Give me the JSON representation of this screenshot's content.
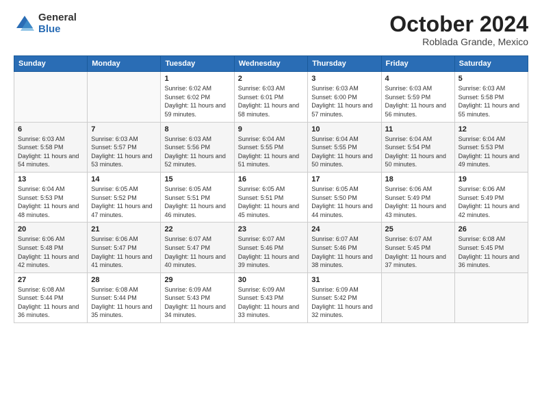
{
  "logo": {
    "general": "General",
    "blue": "Blue"
  },
  "title": "October 2024",
  "location": "Roblada Grande, Mexico",
  "days_header": [
    "Sunday",
    "Monday",
    "Tuesday",
    "Wednesday",
    "Thursday",
    "Friday",
    "Saturday"
  ],
  "weeks": [
    [
      {
        "day": "",
        "info": ""
      },
      {
        "day": "",
        "info": ""
      },
      {
        "day": "1",
        "info": "Sunrise: 6:02 AM\nSunset: 6:02 PM\nDaylight: 11 hours and 59 minutes."
      },
      {
        "day": "2",
        "info": "Sunrise: 6:03 AM\nSunset: 6:01 PM\nDaylight: 11 hours and 58 minutes."
      },
      {
        "day": "3",
        "info": "Sunrise: 6:03 AM\nSunset: 6:00 PM\nDaylight: 11 hours and 57 minutes."
      },
      {
        "day": "4",
        "info": "Sunrise: 6:03 AM\nSunset: 5:59 PM\nDaylight: 11 hours and 56 minutes."
      },
      {
        "day": "5",
        "info": "Sunrise: 6:03 AM\nSunset: 5:58 PM\nDaylight: 11 hours and 55 minutes."
      }
    ],
    [
      {
        "day": "6",
        "info": "Sunrise: 6:03 AM\nSunset: 5:58 PM\nDaylight: 11 hours and 54 minutes."
      },
      {
        "day": "7",
        "info": "Sunrise: 6:03 AM\nSunset: 5:57 PM\nDaylight: 11 hours and 53 minutes."
      },
      {
        "day": "8",
        "info": "Sunrise: 6:03 AM\nSunset: 5:56 PM\nDaylight: 11 hours and 52 minutes."
      },
      {
        "day": "9",
        "info": "Sunrise: 6:04 AM\nSunset: 5:55 PM\nDaylight: 11 hours and 51 minutes."
      },
      {
        "day": "10",
        "info": "Sunrise: 6:04 AM\nSunset: 5:55 PM\nDaylight: 11 hours and 50 minutes."
      },
      {
        "day": "11",
        "info": "Sunrise: 6:04 AM\nSunset: 5:54 PM\nDaylight: 11 hours and 50 minutes."
      },
      {
        "day": "12",
        "info": "Sunrise: 6:04 AM\nSunset: 5:53 PM\nDaylight: 11 hours and 49 minutes."
      }
    ],
    [
      {
        "day": "13",
        "info": "Sunrise: 6:04 AM\nSunset: 5:53 PM\nDaylight: 11 hours and 48 minutes."
      },
      {
        "day": "14",
        "info": "Sunrise: 6:05 AM\nSunset: 5:52 PM\nDaylight: 11 hours and 47 minutes."
      },
      {
        "day": "15",
        "info": "Sunrise: 6:05 AM\nSunset: 5:51 PM\nDaylight: 11 hours and 46 minutes."
      },
      {
        "day": "16",
        "info": "Sunrise: 6:05 AM\nSunset: 5:51 PM\nDaylight: 11 hours and 45 minutes."
      },
      {
        "day": "17",
        "info": "Sunrise: 6:05 AM\nSunset: 5:50 PM\nDaylight: 11 hours and 44 minutes."
      },
      {
        "day": "18",
        "info": "Sunrise: 6:06 AM\nSunset: 5:49 PM\nDaylight: 11 hours and 43 minutes."
      },
      {
        "day": "19",
        "info": "Sunrise: 6:06 AM\nSunset: 5:49 PM\nDaylight: 11 hours and 42 minutes."
      }
    ],
    [
      {
        "day": "20",
        "info": "Sunrise: 6:06 AM\nSunset: 5:48 PM\nDaylight: 11 hours and 42 minutes."
      },
      {
        "day": "21",
        "info": "Sunrise: 6:06 AM\nSunset: 5:47 PM\nDaylight: 11 hours and 41 minutes."
      },
      {
        "day": "22",
        "info": "Sunrise: 6:07 AM\nSunset: 5:47 PM\nDaylight: 11 hours and 40 minutes."
      },
      {
        "day": "23",
        "info": "Sunrise: 6:07 AM\nSunset: 5:46 PM\nDaylight: 11 hours and 39 minutes."
      },
      {
        "day": "24",
        "info": "Sunrise: 6:07 AM\nSunset: 5:46 PM\nDaylight: 11 hours and 38 minutes."
      },
      {
        "day": "25",
        "info": "Sunrise: 6:07 AM\nSunset: 5:45 PM\nDaylight: 11 hours and 37 minutes."
      },
      {
        "day": "26",
        "info": "Sunrise: 6:08 AM\nSunset: 5:45 PM\nDaylight: 11 hours and 36 minutes."
      }
    ],
    [
      {
        "day": "27",
        "info": "Sunrise: 6:08 AM\nSunset: 5:44 PM\nDaylight: 11 hours and 36 minutes."
      },
      {
        "day": "28",
        "info": "Sunrise: 6:08 AM\nSunset: 5:44 PM\nDaylight: 11 hours and 35 minutes."
      },
      {
        "day": "29",
        "info": "Sunrise: 6:09 AM\nSunset: 5:43 PM\nDaylight: 11 hours and 34 minutes."
      },
      {
        "day": "30",
        "info": "Sunrise: 6:09 AM\nSunset: 5:43 PM\nDaylight: 11 hours and 33 minutes."
      },
      {
        "day": "31",
        "info": "Sunrise: 6:09 AM\nSunset: 5:42 PM\nDaylight: 11 hours and 32 minutes."
      },
      {
        "day": "",
        "info": ""
      },
      {
        "day": "",
        "info": ""
      }
    ]
  ]
}
